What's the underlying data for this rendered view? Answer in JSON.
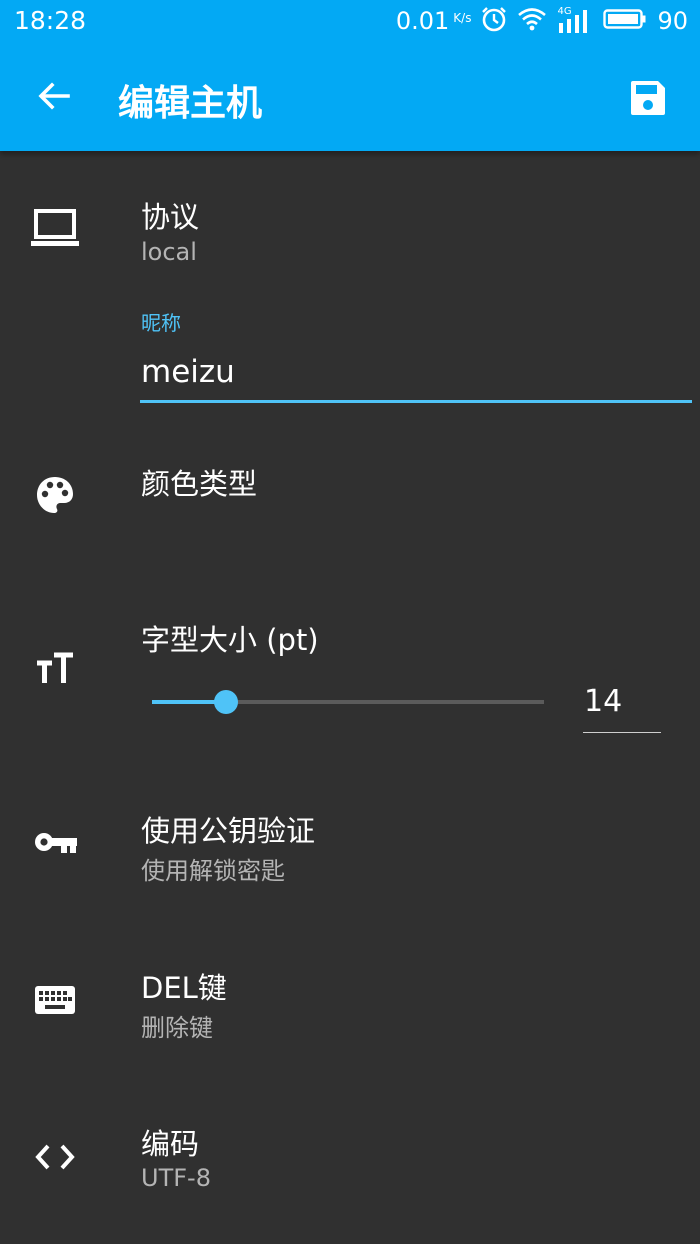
{
  "status_bar": {
    "time": "18:28",
    "net_speed": "0.01",
    "net_speed_unit": "K/s",
    "signal_label": "4G",
    "battery": "90"
  },
  "app_bar": {
    "title": "编辑主机",
    "back_icon": "arrow-left-icon",
    "save_icon": "floppy-disk-icon"
  },
  "protocol": {
    "title": "协议",
    "value": "local",
    "icon": "laptop-icon"
  },
  "nickname": {
    "label": "昵称",
    "value": "meizu"
  },
  "color_scheme": {
    "title": "颜色类型",
    "icon": "palette-icon"
  },
  "font_size": {
    "title": "字型大小 (pt)",
    "value": "14",
    "slider_fraction": 0.19,
    "icon": "text-size-icon"
  },
  "pubkey": {
    "title": "使用公钥验证",
    "value": "使用解锁密匙",
    "icon": "key-icon"
  },
  "del_key": {
    "title": "DEL键",
    "value": "删除键",
    "icon": "keyboard-icon"
  },
  "encoding": {
    "title": "编码",
    "value": "UTF-8",
    "icon": "code-brackets-icon"
  },
  "colors": {
    "accent": "#03A9F4",
    "accent_light": "#4FC3F7",
    "background": "#303030"
  }
}
